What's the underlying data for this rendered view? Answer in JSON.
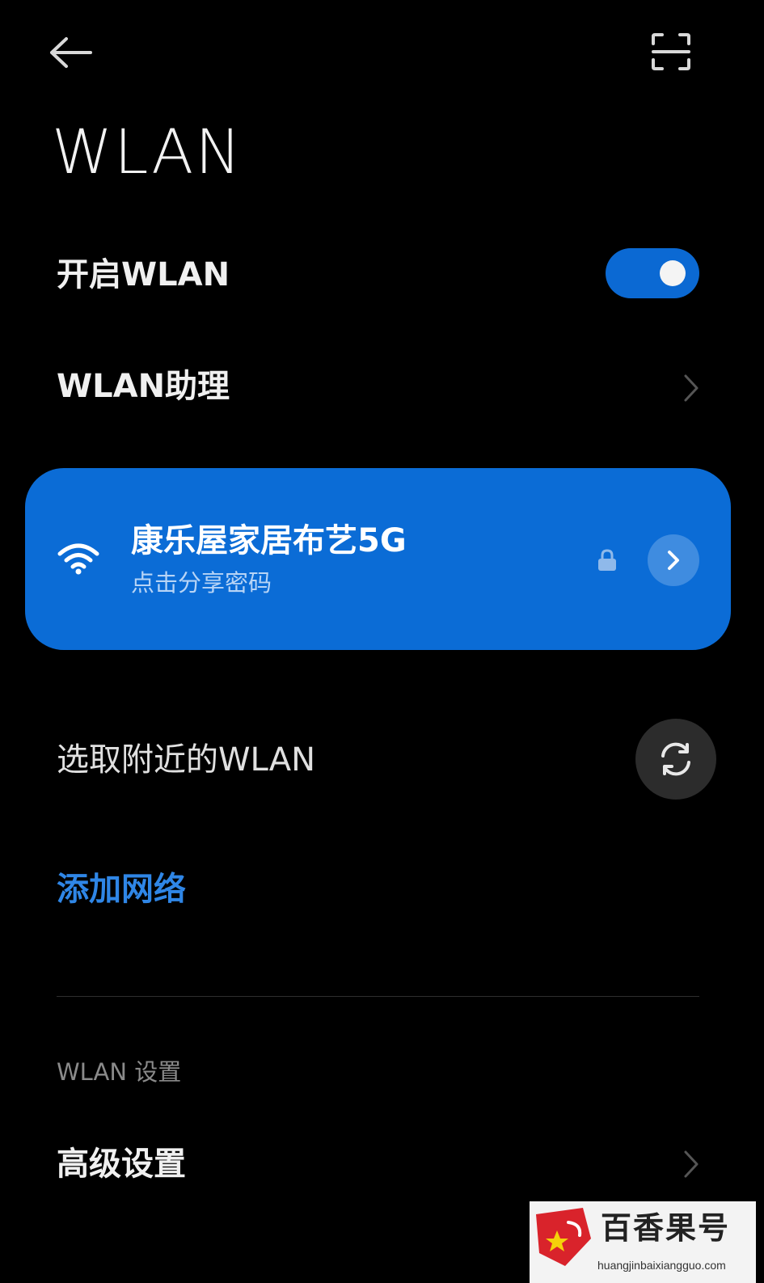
{
  "header": {
    "title": "WLAN",
    "back_icon": "arrow-left-icon",
    "scan_icon": "scan-qr-icon"
  },
  "settings": {
    "enable_wlan_label": "开启WLAN",
    "enable_wlan_on": true,
    "assistant_label": "WLAN助理"
  },
  "connected_network": {
    "name": "康乐屋家居布艺5G",
    "subtitle": "点击分享密码",
    "secured": true,
    "card_color": "#0b6cd6"
  },
  "nearby": {
    "label": "选取附近的WLAN",
    "refresh_icon": "refresh-icon"
  },
  "add_network": {
    "label": "添加网络",
    "color": "#2f86e6"
  },
  "wlan_settings": {
    "section_header": "WLAN 设置",
    "advanced_label": "高级设置"
  },
  "watermark": {
    "title": "百香果号",
    "url": "huangjinbaixiangguo.com"
  },
  "colors": {
    "background": "#000000",
    "accent": "#0b69d3"
  }
}
